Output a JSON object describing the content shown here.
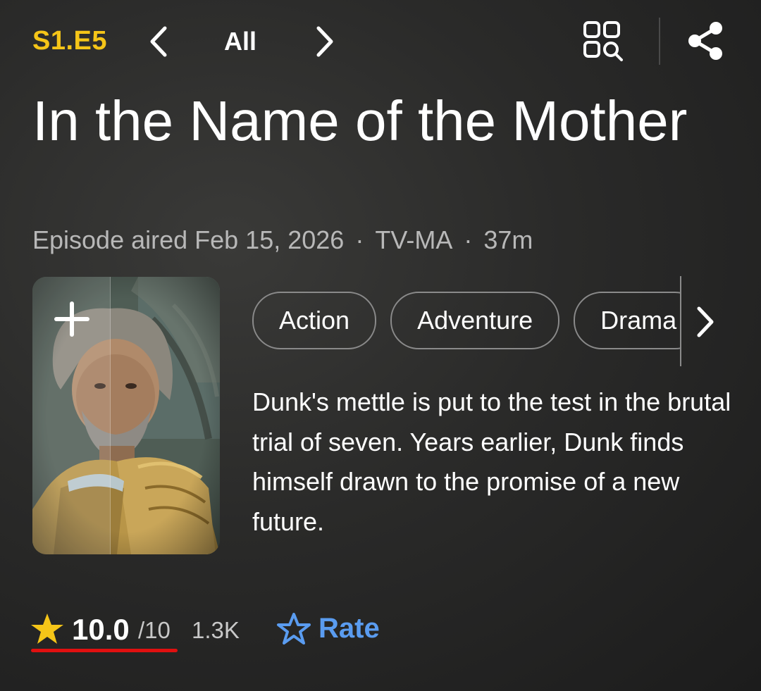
{
  "header": {
    "episode_code": "S1.E5",
    "all_label": "All",
    "prev_icon": "chevron-left-icon",
    "next_icon": "chevron-right-icon",
    "grid_search_icon": "grid-search-icon",
    "share_icon": "share-icon"
  },
  "episode": {
    "title": "In the Name of the Mother",
    "aired": "Episode aired Feb 15, 2026",
    "separator": "·",
    "rating_cert": "TV-MA",
    "runtime": "37m"
  },
  "poster": {
    "add_icon": "plus-icon"
  },
  "genres": [
    "Action",
    "Adventure",
    "Drama"
  ],
  "plot": "Dunk's mettle is put to the test in the brutal trial of seven. Years earlier, Dunk finds himself drawn to the promise of a new future.",
  "rating": {
    "value": "10.0",
    "max": "/10",
    "count": "1.3K",
    "rate_label": "Rate"
  },
  "colors": {
    "accent_yellow": "#f5c518",
    "rate_blue": "#5a9cf0",
    "underline_red": "#e01010"
  }
}
